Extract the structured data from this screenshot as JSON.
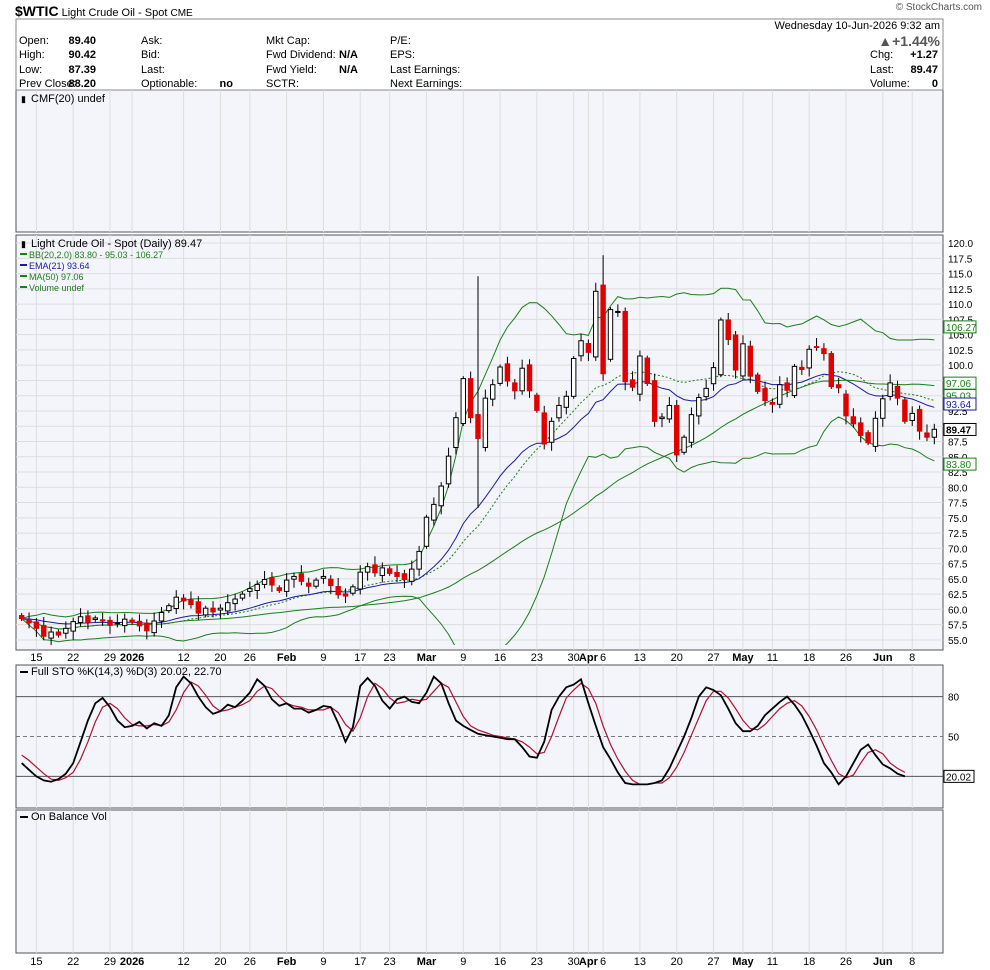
{
  "header": {
    "symbol": "$WTIC",
    "name": "Light Crude Oil - Spot",
    "exchange": "CME",
    "watermark": "© StockCharts.com",
    "date": "Wednesday  10-Jun-2026  9:32 am",
    "pct_change": "▲+1.44%",
    "left": [
      {
        "label": "Open:",
        "value": "89.40"
      },
      {
        "label": "High:",
        "value": "90.42"
      },
      {
        "label": "Low:",
        "value": "87.39"
      },
      {
        "label": "Prev Close:",
        "value": "88.20"
      }
    ],
    "mid": [
      {
        "label": "Ask:",
        "value": ""
      },
      {
        "label": "Bid:",
        "value": ""
      },
      {
        "label": "Last:",
        "value": ""
      },
      {
        "label": "Optionable:",
        "value": "no"
      }
    ],
    "fund": [
      {
        "label": "Mkt Cap:",
        "value": ""
      },
      {
        "label": "Fwd Dividend:",
        "value": "N/A"
      },
      {
        "label": "Fwd Yield:",
        "value": "N/A"
      },
      {
        "label": "SCTR:",
        "value": ""
      }
    ],
    "earn": [
      {
        "label": "P/E:",
        "value": ""
      },
      {
        "label": "EPS:",
        "value": ""
      },
      {
        "label": "Last Earnings:",
        "value": ""
      },
      {
        "label": "Next Earnings:",
        "value": ""
      }
    ],
    "right": [
      {
        "label": "Chg:",
        "value": "+1.27"
      },
      {
        "label": "Last:",
        "value": "89.47"
      },
      {
        "label": "Volume:",
        "value": "0"
      }
    ]
  },
  "colors": {
    "up": "#ffffff",
    "down": "#e00000",
    "bb": "#1a7f1a",
    "ema": "#1a1aa0",
    "ma": "#1a7f1a",
    "sto_k": "#000000",
    "sto_d": "#b01030",
    "grid": "#dddddd"
  },
  "chart_data": [
    {
      "type": "label",
      "title": "CMF(20) undef"
    },
    {
      "type": "candlestick",
      "title": "Light Crude Oil - Spot (Daily) 89.47",
      "legend": [
        "BB(20,2.0) 83.80 - 95.03 - 106.27",
        "EMA(21) 93.64",
        "MA(50) 97.06",
        "Volume undef"
      ],
      "y_ticks": [
        "120.0",
        "117.5",
        "115.0",
        "112.5",
        "110.0",
        "107.5",
        "105.0",
        "102.5",
        "100.0",
        "97.5",
        "95.0",
        "92.5",
        "90.0",
        "87.5",
        "85.0",
        "82.5",
        "80.0",
        "77.5",
        "75.0",
        "72.5",
        "70.0",
        "67.5",
        "65.0",
        "62.5",
        "60.0",
        "57.5",
        "55.0"
      ],
      "ylim": [
        54.5,
        120.5
      ],
      "price_tags": [
        {
          "label": "106.27",
          "value": 106.27,
          "color": "#1a7f1a"
        },
        {
          "label": "97.06",
          "value": 97.06,
          "color": "#1a7f1a"
        },
        {
          "label": "95.03",
          "value": 95.03,
          "color": "#1a7f1a"
        },
        {
          "label": "93.64",
          "value": 93.64,
          "color": "#1a1aa0"
        },
        {
          "label": "89.47",
          "value": 89.47,
          "color": "#000000"
        },
        {
          "label": "83.80",
          "value": 83.8,
          "color": "#1a7f1a"
        }
      ],
      "x_ticks": [
        {
          "label": "15",
          "i": 2
        },
        {
          "label": "22",
          "i": 7
        },
        {
          "label": "29",
          "i": 12
        },
        {
          "label": "2026",
          "i": 15,
          "bold": true
        },
        {
          "label": "12",
          "i": 22
        },
        {
          "label": "20",
          "i": 27
        },
        {
          "label": "26",
          "i": 31
        },
        {
          "label": "Feb",
          "i": 36,
          "bold": true
        },
        {
          "label": "9",
          "i": 41
        },
        {
          "label": "17",
          "i": 46
        },
        {
          "label": "23",
          "i": 50
        },
        {
          "label": "Mar",
          "i": 55,
          "bold": true
        },
        {
          "label": "9",
          "i": 60
        },
        {
          "label": "16",
          "i": 65
        },
        {
          "label": "23",
          "i": 70
        },
        {
          "label": "30",
          "i": 75
        },
        {
          "label": "Apr",
          "i": 77,
          "bold": true
        },
        {
          "label": "6",
          "i": 79
        },
        {
          "label": "13",
          "i": 84
        },
        {
          "label": "20",
          "i": 89
        },
        {
          "label": "27",
          "i": 94
        },
        {
          "label": "May",
          "i": 98,
          "bold": true
        },
        {
          "label": "11",
          "i": 102
        },
        {
          "label": "18",
          "i": 107
        },
        {
          "label": "26",
          "i": 112
        },
        {
          "label": "Jun",
          "i": 117,
          "bold": true
        },
        {
          "label": "8",
          "i": 121
        }
      ],
      "closes": [
        58.5,
        57.8,
        56.9,
        55.6,
        56.3,
        55.8,
        56.9,
        58.0,
        58.8,
        57.9,
        58.6,
        58.2,
        57.4,
        57.8,
        58.4,
        57.9,
        57.3,
        56.5,
        58.1,
        59.5,
        60.6,
        62.0,
        61.4,
        60.8,
        59.4,
        60.2,
        59.6,
        60.2,
        61.1,
        61.7,
        62.5,
        63.4,
        64.1,
        64.9,
        64.0,
        63.1,
        64.8,
        65.4,
        64.6,
        63.8,
        64.8,
        65.4,
        63.9,
        62.4,
        62.2,
        63.7,
        66.1,
        67.0,
        66.0,
        66.8,
        65.9,
        65.4,
        64.9,
        66.6,
        69.5,
        75.1,
        77.2,
        80.2,
        85.1,
        91.4,
        97.8,
        91.4,
        88.0,
        94.6,
        96.8,
        99.7,
        97.4,
        95.8,
        99.5,
        95.8,
        92.6,
        87.1,
        90.8,
        93.4,
        94.9,
        101.1,
        104.0,
        102.1,
        112.1,
        98.6,
        109.1,
        108.8,
        97.3,
        96.4,
        101.5,
        97.0,
        90.8,
        91.5,
        93.4,
        85.3,
        88.2,
        91.9,
        94.7,
        96.2,
        99.6,
        107.4,
        104.2,
        99.2,
        103.5,
        98.2,
        95.7,
        94.2,
        93.6,
        96.8,
        95.9,
        99.8,
        99.3,
        102.6,
        103.0,
        101.9,
        96.5,
        96.3,
        91.7,
        90.4,
        88.5,
        87.3,
        91.3,
        94.5,
        97.1,
        94.6,
        90.8,
        92.1,
        89.2,
        88.2,
        89.5
      ],
      "candle_style": "hollow-up / filled-down",
      "indicators": [
        "BB(20,2.0)",
        "EMA(21)",
        "MA(50)"
      ]
    },
    {
      "type": "line",
      "title": "Full STO %K(14,3) %D(3) 20.02, 22.70",
      "series": [
        {
          "name": "%K"
        },
        {
          "name": "%D"
        }
      ],
      "ylim": [
        0,
        100
      ],
      "levels": [
        20,
        50,
        80
      ],
      "y_ticks": [
        "80",
        "50"
      ],
      "last_tag": "20.02",
      "k_values": [
        30,
        25,
        20,
        17,
        16,
        18,
        22,
        30,
        46,
        62,
        75,
        79,
        72,
        62,
        57,
        58,
        61,
        56,
        60,
        58,
        66,
        87,
        95,
        90,
        80,
        72,
        67,
        69,
        74,
        72,
        77,
        83,
        93,
        88,
        78,
        73,
        75,
        71,
        71,
        68,
        70,
        73,
        72,
        60,
        46,
        57,
        88,
        94,
        88,
        77,
        71,
        78,
        80,
        76,
        75,
        83,
        95,
        90,
        75,
        62,
        58,
        55,
        52,
        51,
        50,
        49,
        48,
        48,
        42,
        35,
        34,
        46,
        70,
        80,
        87,
        89,
        93,
        75,
        58,
        42,
        33,
        23,
        15,
        14,
        14,
        14,
        15,
        17,
        26,
        38,
        50,
        64,
        80,
        87,
        85,
        81,
        71,
        60,
        54,
        54,
        58,
        66,
        71,
        76,
        80,
        74,
        66,
        55,
        43,
        30,
        23,
        14,
        20,
        30,
        40,
        44,
        36,
        29,
        26,
        22,
        20
      ],
      "d_values": [
        36,
        32,
        27,
        22,
        18,
        17,
        19,
        23,
        33,
        46,
        61,
        72,
        75,
        71,
        64,
        59,
        58,
        58,
        59,
        58,
        61,
        70,
        83,
        91,
        88,
        81,
        73,
        69,
        70,
        72,
        74,
        77,
        84,
        88,
        86,
        80,
        75,
        73,
        72,
        70,
        70,
        70,
        72,
        68,
        59,
        54,
        64,
        80,
        90,
        86,
        79,
        75,
        76,
        78,
        77,
        78,
        84,
        90,
        87,
        76,
        65,
        58,
        55,
        53,
        51,
        50,
        49,
        48,
        46,
        42,
        37,
        38,
        50,
        65,
        79,
        85,
        90,
        86,
        75,
        58,
        44,
        33,
        24,
        17,
        14,
        14,
        15,
        15,
        19,
        27,
        38,
        51,
        64,
        77,
        84,
        84,
        79,
        71,
        62,
        56,
        55,
        59,
        65,
        71,
        75,
        77,
        73,
        65,
        55,
        43,
        32,
        22,
        19,
        21,
        30,
        38,
        40,
        37,
        30,
        26,
        23
      ]
    },
    {
      "type": "line",
      "title": "On Balance Vol",
      "series": []
    }
  ]
}
